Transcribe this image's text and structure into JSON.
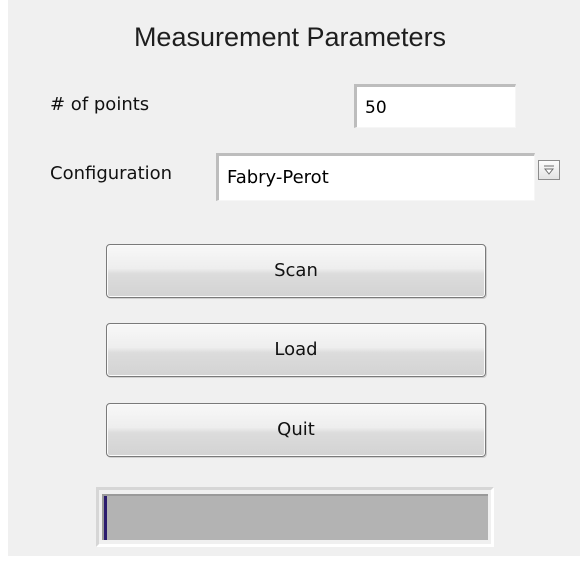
{
  "panel": {
    "title": "Measurement Parameters"
  },
  "points": {
    "label": "# of points",
    "value": "50"
  },
  "configuration": {
    "label": "Configuration",
    "selected": "Fabry-Perot",
    "arrow_icon": "dropdown-arrow-icon"
  },
  "buttons": {
    "scan": "Scan",
    "load": "Load",
    "quit": "Quit"
  },
  "progress": {
    "value": 0,
    "fill_color": "#2b1b6e",
    "track_color": "#b3b3b3"
  }
}
